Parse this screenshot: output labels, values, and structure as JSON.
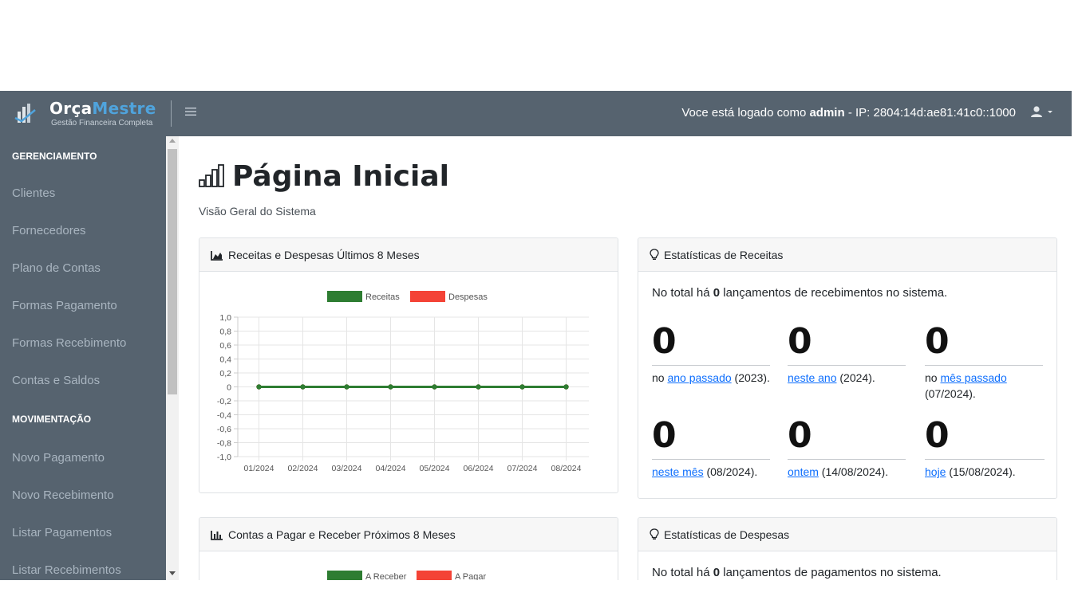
{
  "brand": {
    "name_part1": "Orça",
    "name_part2": "Mestre",
    "subtitle": "Gestão Financeira Completa"
  },
  "topbar": {
    "logged_prefix": "Voce está logado como ",
    "user": "admin",
    "ip_text": " - IP: 2804:14d:ae81:41c0::1000"
  },
  "sidebar": {
    "sections": [
      {
        "heading": "GERENCIAMENTO",
        "items": [
          "Clientes",
          "Fornecedores",
          "Plano de Contas",
          "Formas Pagamento",
          "Formas Recebimento",
          "Contas e Saldos"
        ]
      },
      {
        "heading": "MOVIMENTAÇÃO",
        "items": [
          "Novo Pagamento",
          "Novo Recebimento",
          "Listar Pagamentos",
          "Listar Recebimentos"
        ]
      }
    ]
  },
  "page": {
    "title": "Página Inicial",
    "subtitle": "Visão Geral do Sistema"
  },
  "card_chart1": {
    "title": "Receitas e Despesas Últimos 8 Meses"
  },
  "card_chart2": {
    "title": "Contas a Pagar e Receber Próximos 8 Meses"
  },
  "card_receitas": {
    "title": "Estatísticas de Receitas",
    "intro_pre": "No total há ",
    "intro_count": "0",
    "intro_post": " lançamentos de recebimentos no sistema.",
    "stats": [
      {
        "value": "0",
        "pre": "no ",
        "link": "ano passado",
        "post": " (2023)."
      },
      {
        "value": "0",
        "pre": "",
        "link": "neste ano",
        "post": " (2024)."
      },
      {
        "value": "0",
        "pre": "no ",
        "link": "mês passado",
        "post": " (07/2024)."
      },
      {
        "value": "0",
        "pre": "",
        "link": "neste mês",
        "post": " (08/2024)."
      },
      {
        "value": "0",
        "pre": "",
        "link": "ontem",
        "post": " (14/08/2024)."
      },
      {
        "value": "0",
        "pre": "",
        "link": "hoje",
        "post": " (15/08/2024)."
      }
    ]
  },
  "card_despesas": {
    "title": "Estatísticas de Despesas",
    "intro_pre": "No total há ",
    "intro_count": "0",
    "intro_post": " lançamentos de pagamentos no sistema."
  },
  "colors": {
    "topbar": "#56636f",
    "series_receitas": "#2e7d32",
    "series_despesas": "#f44336",
    "link": "#0d6efd"
  },
  "chart_data": [
    {
      "type": "line",
      "categories": [
        "01/2024",
        "02/2024",
        "03/2024",
        "04/2024",
        "05/2024",
        "06/2024",
        "07/2024",
        "08/2024"
      ],
      "series": [
        {
          "name": "Receitas",
          "values": [
            0,
            0,
            0,
            0,
            0,
            0,
            0,
            0
          ],
          "color": "#2e7d32"
        },
        {
          "name": "Despesas",
          "values": [
            0,
            0,
            0,
            0,
            0,
            0,
            0,
            0
          ],
          "color": "#f44336"
        }
      ],
      "yticks": [
        "1,0",
        "0,8",
        "0,6",
        "0,4",
        "0,2",
        "0",
        "-0,2",
        "-0,4",
        "-0,6",
        "-0,8",
        "-1,0"
      ],
      "ylim": [
        -1,
        1
      ],
      "grid": true,
      "legend": "top"
    },
    {
      "type": "bar",
      "legend_entries": [
        "A Receber",
        "A Pagar"
      ],
      "legend_colors": [
        "#2e7d32",
        "#f44336"
      ],
      "legend": "top"
    }
  ]
}
